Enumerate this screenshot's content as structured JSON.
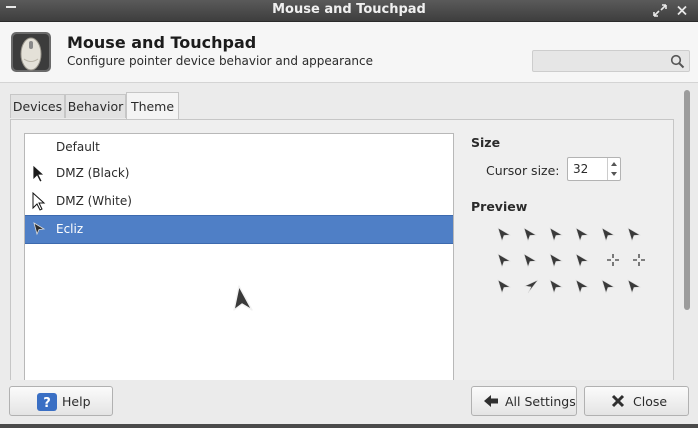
{
  "window": {
    "title": "Mouse and Touchpad"
  },
  "header": {
    "title": "Mouse and Touchpad",
    "subtitle": "Configure pointer device behavior and appearance",
    "search_placeholder": ""
  },
  "tabs": [
    {
      "label": "Devices"
    },
    {
      "label": "Behavior"
    },
    {
      "label": "Theme",
      "active": true
    }
  ],
  "theme_list": {
    "items": [
      {
        "label": "Default",
        "cursor": "none"
      },
      {
        "label": "DMZ (Black)",
        "cursor": "black-arrow"
      },
      {
        "label": "DMZ (White)",
        "cursor": "white-arrow"
      },
      {
        "label": "Ecliz",
        "cursor": "ecliz-arrow",
        "selected": true
      }
    ]
  },
  "size_section": {
    "heading": "Size",
    "cursor_size_label": "Cursor size:",
    "cursor_size_value": "32"
  },
  "preview_section": {
    "heading": "Preview"
  },
  "buttons": {
    "help": "Help",
    "all_settings": "All Settings",
    "close": "Close"
  },
  "colors": {
    "selection": "#4f7fc6",
    "titlebar": "#4a4a4a",
    "help_icon": "#3a6fc4"
  }
}
